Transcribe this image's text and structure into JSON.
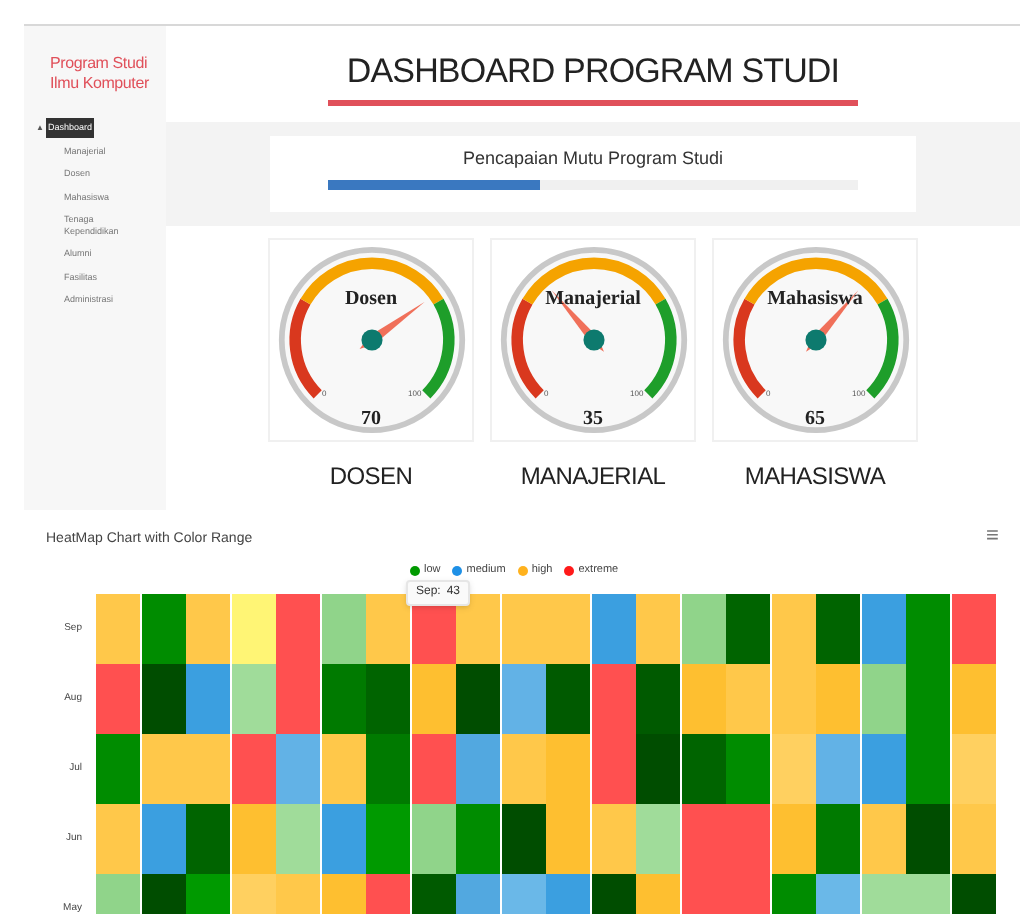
{
  "sidebar": {
    "brand": "Program Studi\nIlmu Komputer",
    "items": [
      {
        "label": "Dashboard",
        "selected": true,
        "caret": "▲"
      },
      {
        "label": "Manajerial",
        "selected": false
      },
      {
        "label": "Dosen",
        "selected": false
      },
      {
        "label": "Mahasiswa",
        "selected": false
      },
      {
        "label": "Tenaga Kependidikan",
        "selected": false
      },
      {
        "label": "Alumni",
        "selected": false
      },
      {
        "label": "Fasilitas",
        "selected": false
      },
      {
        "label": "Administrasi",
        "selected": false
      }
    ]
  },
  "header": {
    "title": "DASHBOARD PROGRAM STUDI"
  },
  "progress": {
    "title": "Pencapaian Mutu Program Studi",
    "level": 0.4
  },
  "gauges": [
    {
      "title": "Dosen",
      "value": "70",
      "min": "0",
      "max": "100",
      "caption": "DOSEN"
    },
    {
      "title": "Manajerial",
      "value": "35",
      "min": "0",
      "max": "100",
      "caption": "MANAJERIAL"
    },
    {
      "title": "Mahasiswa",
      "value": "65",
      "min": "0",
      "max": "100",
      "caption": "MAHASISWA"
    }
  ],
  "heatmap": {
    "title": "HeatMap Chart with Color Range",
    "menu": "≡",
    "legend": [
      {
        "label": "low",
        "color": "#009a00"
      },
      {
        "label": "medium",
        "color": "#1e90e6"
      },
      {
        "label": "high",
        "color": "#ffb21e"
      },
      {
        "label": "extreme",
        "color": "#ff1a1a"
      }
    ],
    "tooltip": {
      "label": "Sep:",
      "value": "43"
    },
    "rows": [
      {
        "label": "Sep",
        "cells": [
          {
            "color": "#ffc84a"
          },
          {
            "color": "#008c00"
          },
          {
            "color": "#ffc84a"
          },
          {
            "color": "#fff575"
          },
          {
            "color": "#ff5050"
          },
          {
            "color": "#90d48a"
          },
          {
            "color": "#ffc84a"
          },
          {
            "color": "#ff5050"
          },
          {
            "color": "#ffc84a"
          },
          {
            "color": "#ffc84a"
          },
          {
            "color": "#ffc84a"
          },
          {
            "color": "#3b9fe0"
          },
          {
            "color": "#ffc84a"
          },
          {
            "color": "#90d48a"
          },
          {
            "color": "#006400"
          },
          {
            "color": "#ffc84a"
          },
          {
            "color": "#006400"
          },
          {
            "color": "#3b9fe0"
          },
          {
            "color": "#008c00"
          },
          {
            "color": "#ff5050"
          }
        ]
      },
      {
        "label": "Aug",
        "cells": [
          {
            "color": "#ff5050"
          },
          {
            "color": "#004d00"
          },
          {
            "color": "#3b9fe0"
          },
          {
            "color": "#a0dc9a"
          },
          {
            "color": "#ff5050"
          },
          {
            "color": "#007a00"
          },
          {
            "color": "#006400"
          },
          {
            "color": "#febf30"
          },
          {
            "color": "#004d00"
          },
          {
            "color": "#62b2e6"
          },
          {
            "color": "#005a00"
          },
          {
            "color": "#ff5050"
          },
          {
            "color": "#005a00"
          },
          {
            "color": "#febf30"
          },
          {
            "color": "#ffc84a"
          },
          {
            "color": "#ffc84a"
          },
          {
            "color": "#febf30"
          },
          {
            "color": "#90d48a"
          },
          {
            "color": "#008c00"
          },
          {
            "color": "#febf30"
          }
        ]
      },
      {
        "label": "Jul",
        "cells": [
          {
            "color": "#008c00"
          },
          {
            "color": "#ffc84a"
          },
          {
            "color": "#ffc84a"
          },
          {
            "color": "#ff5050"
          },
          {
            "color": "#62b2e6"
          },
          {
            "color": "#ffc84a"
          },
          {
            "color": "#007a00"
          },
          {
            "color": "#ff5050"
          },
          {
            "color": "#52a8e0"
          },
          {
            "color": "#ffc84a"
          },
          {
            "color": "#febf30"
          },
          {
            "color": "#ff5050"
          },
          {
            "color": "#004d00"
          },
          {
            "color": "#006400"
          },
          {
            "color": "#008c00"
          },
          {
            "color": "#ffd060"
          },
          {
            "color": "#62b2e6"
          },
          {
            "color": "#3b9fe0"
          },
          {
            "color": "#008c00"
          },
          {
            "color": "#ffd060"
          }
        ]
      },
      {
        "label": "Jun",
        "cells": [
          {
            "color": "#ffc84a"
          },
          {
            "color": "#3b9fe0"
          },
          {
            "color": "#006400"
          },
          {
            "color": "#febf30"
          },
          {
            "color": "#a0dc9a"
          },
          {
            "color": "#3b9fe0"
          },
          {
            "color": "#009a00"
          },
          {
            "color": "#90d48a"
          },
          {
            "color": "#008c00"
          },
          {
            "color": "#004d00"
          },
          {
            "color": "#febf30"
          },
          {
            "color": "#ffc84a"
          },
          {
            "color": "#a0dc9a"
          },
          {
            "color": "#ff5050"
          },
          {
            "color": "#ff5050"
          },
          {
            "color": "#febf30"
          },
          {
            "color": "#007a00"
          },
          {
            "color": "#ffc84a"
          },
          {
            "color": "#004d00"
          },
          {
            "color": "#ffc84a"
          }
        ]
      },
      {
        "label": "May",
        "cells": [
          {
            "color": "#90d48a"
          },
          {
            "color": "#004d00"
          },
          {
            "color": "#009a00"
          },
          {
            "color": "#ffd060"
          },
          {
            "color": "#ffc84a"
          },
          {
            "color": "#febf30"
          },
          {
            "color": "#ff5050"
          },
          {
            "color": "#005a00"
          },
          {
            "color": "#52a8e0"
          },
          {
            "color": "#6ab8e8"
          },
          {
            "color": "#3b9fe0"
          },
          {
            "color": "#004d00"
          },
          {
            "color": "#febf30"
          },
          {
            "color": "#ff5050"
          },
          {
            "color": "#ff5050"
          },
          {
            "color": "#008c00"
          },
          {
            "color": "#6ab8e8"
          },
          {
            "color": "#a0dc9a"
          },
          {
            "color": "#a0dc9a"
          },
          {
            "color": "#004d00"
          }
        ]
      }
    ]
  }
}
